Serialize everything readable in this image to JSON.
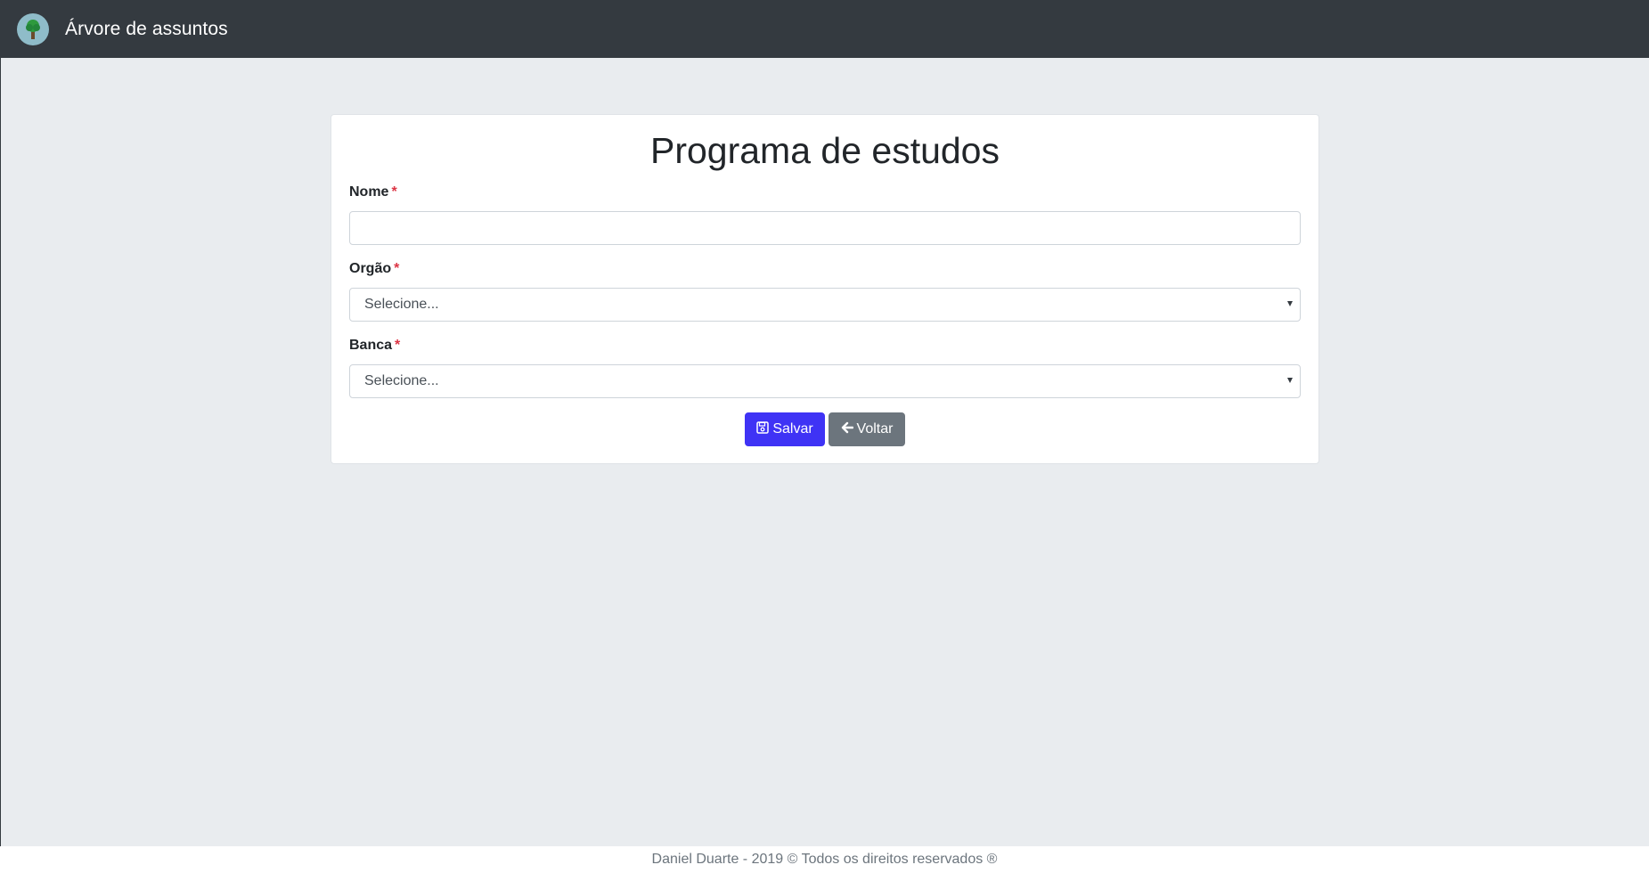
{
  "app": {
    "brand": "Árvore de assuntos",
    "logo_icon": "tree-icon"
  },
  "form": {
    "title": "Programa de estudos",
    "required_marker": "*",
    "nome": {
      "label": "Nome",
      "value": ""
    },
    "orgao": {
      "label": "Orgão",
      "selected": "Selecione..."
    },
    "banca": {
      "label": "Banca",
      "selected": "Selecione..."
    },
    "buttons": {
      "save_label": "Salvar",
      "save_icon": "save-icon",
      "back_label": "Voltar",
      "back_icon": "arrow-left-icon"
    }
  },
  "footer": {
    "text": "Daniel Duarte - 2019 © Todos os direitos reservados ®"
  },
  "colors": {
    "navbar": "#343a40",
    "background": "#e9ecef",
    "primary": "#3f33f5",
    "secondary": "#6c757d",
    "required": "#dc3545"
  }
}
